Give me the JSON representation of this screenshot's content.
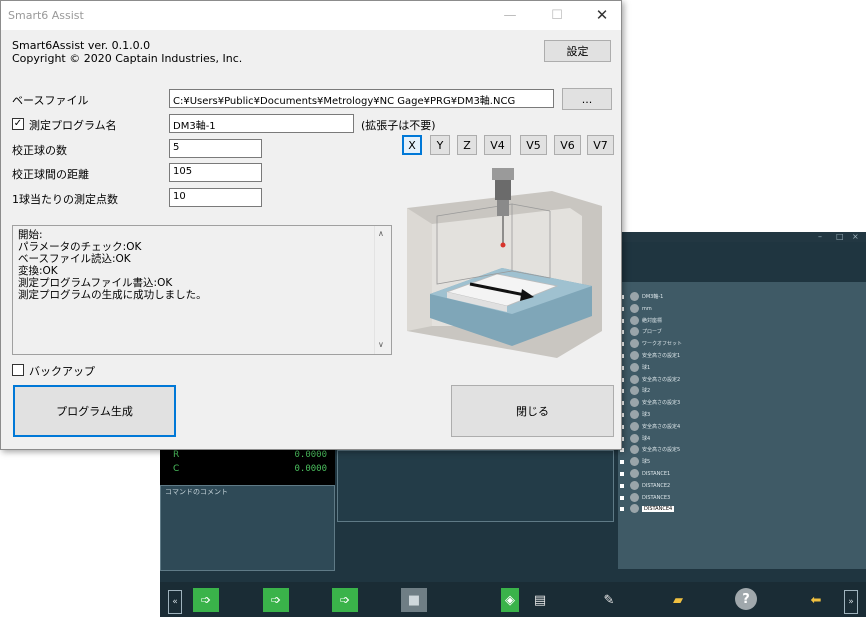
{
  "dialog": {
    "title": "Smart6 Assist",
    "version": "Smart6Assist ver. 0.1.0.0",
    "copyright": "Copyright ©  2020 Captain Industries, Inc.",
    "settings_label": "設定",
    "base_file_label": "ベースファイル",
    "base_file_value": "C:¥Users¥Public¥Documents¥Metrology¥NC Gage¥PRG¥DM3軸.NCG",
    "browse_label": "...",
    "program_name_checked": true,
    "program_name_label": "測定プログラム名",
    "program_name_value": "DM3軸-1",
    "extension_note": "(拡張子は不要)",
    "sphere_count_label": "校正球の数",
    "sphere_count_value": "5",
    "sphere_distance_label": "校正球間の距離",
    "sphere_distance_value": "105",
    "points_label": "1球当たりの測定点数",
    "points_value": "10",
    "axis_buttons": [
      "X",
      "Y",
      "Z",
      "V4",
      "V5",
      "V6",
      "V7"
    ],
    "selected_axis": "X",
    "log_lines": [
      "開始:",
      "パラメータのチェック:OK",
      "ベースファイル読込:OK",
      "変換:OK",
      "測定プログラムファイル書込:OK",
      "測定プログラムの生成に成功しました。"
    ],
    "backup_checked": false,
    "backup_label": "バックアップ",
    "generate_label": "プログラム生成",
    "close_label": "閉じる"
  },
  "background_app": {
    "dro": [
      {
        "axis": "R",
        "value": "0.0000"
      },
      {
        "axis": "C",
        "value": "0.0000"
      }
    ],
    "comment_title": "コマンドのコメント",
    "tree_items": [
      {
        "label": "DM3軸-1"
      },
      {
        "label": "mm"
      },
      {
        "label": "絶対座標"
      },
      {
        "label": "プローブ"
      },
      {
        "label": "ワークオフセット"
      },
      {
        "label": "安全高さの設定1"
      },
      {
        "label": "球1"
      },
      {
        "label": "安全高さの設定2"
      },
      {
        "label": "球2"
      },
      {
        "label": "安全高さの設定3"
      },
      {
        "label": "球3"
      },
      {
        "label": "安全高さの設定4"
      },
      {
        "label": "球4"
      },
      {
        "label": "安全高さの設定5"
      },
      {
        "label": "球5"
      },
      {
        "label": "DISTANCE1"
      },
      {
        "label": "DISTANCE2"
      },
      {
        "label": "DISTANCE3"
      },
      {
        "label": "DISTANCE4"
      }
    ],
    "selected_tree_item": "DISTANCE4",
    "colors": {
      "background": "#1f3540",
      "tree": "#3f5a66",
      "accent_green": "#3ab34a",
      "focus_blue": "#0078d7"
    }
  }
}
